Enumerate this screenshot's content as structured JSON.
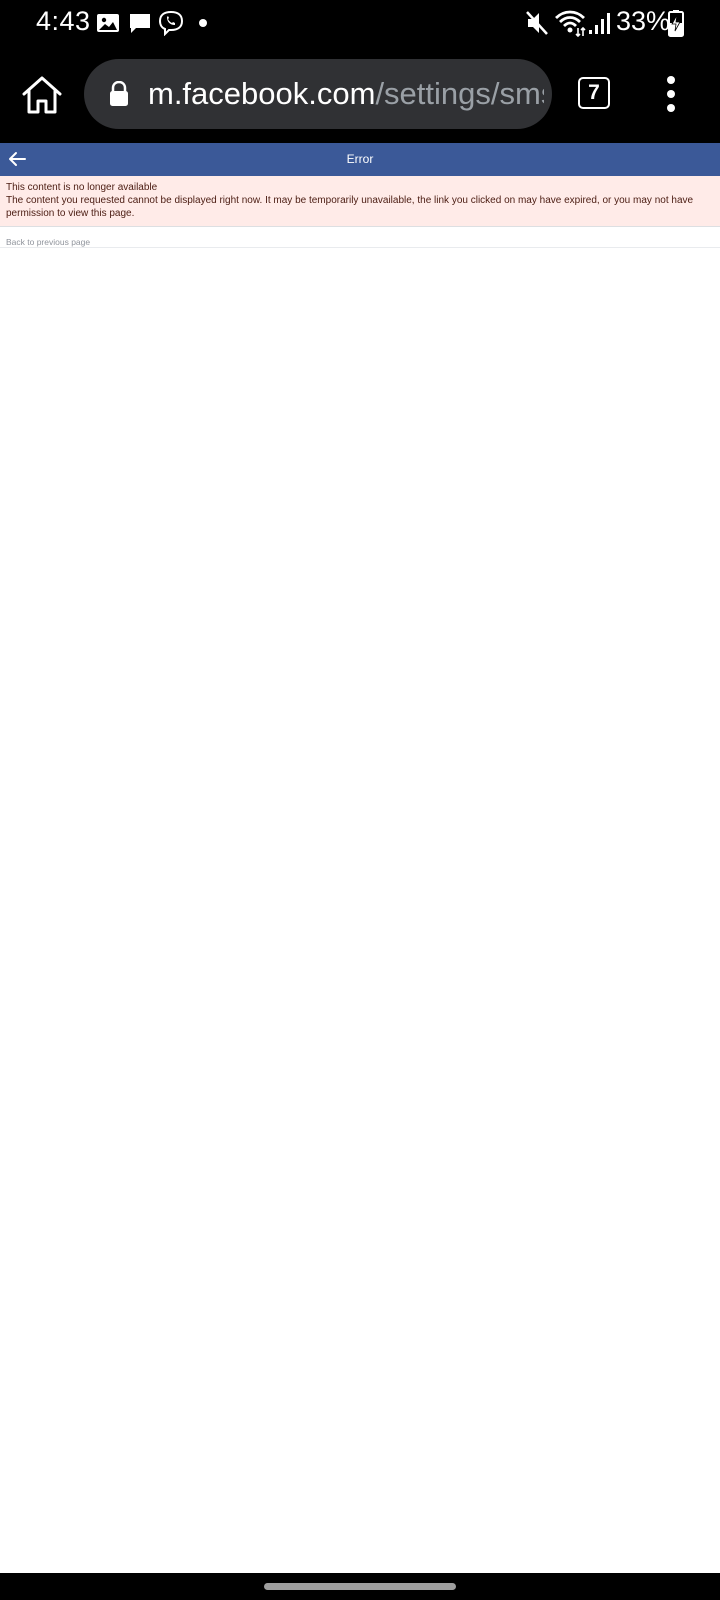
{
  "status_bar": {
    "time": "4:43",
    "battery": "33%",
    "notification_icons": [
      "image-icon",
      "message-icon",
      "viber-icon",
      "dot-icon"
    ],
    "system_icons": [
      "mute-icon",
      "wifi-icon",
      "signal-icon",
      "battery-charging-icon"
    ]
  },
  "browser": {
    "url_host": "m.facebook.com",
    "url_path": "/settings/sms/",
    "tab_count": "7"
  },
  "page": {
    "header_title": "Error",
    "error_title": "This content is no longer available",
    "error_message": "The content you requested cannot be displayed right now. It may be temporarily unavailable, the link you clicked on may have expired, or you may not have permission to view this page.",
    "back_link": "Back to previous page"
  },
  "colors": {
    "facebook_blue": "#3b5998",
    "error_background": "#ffebe8",
    "url_bar": "#303134"
  }
}
